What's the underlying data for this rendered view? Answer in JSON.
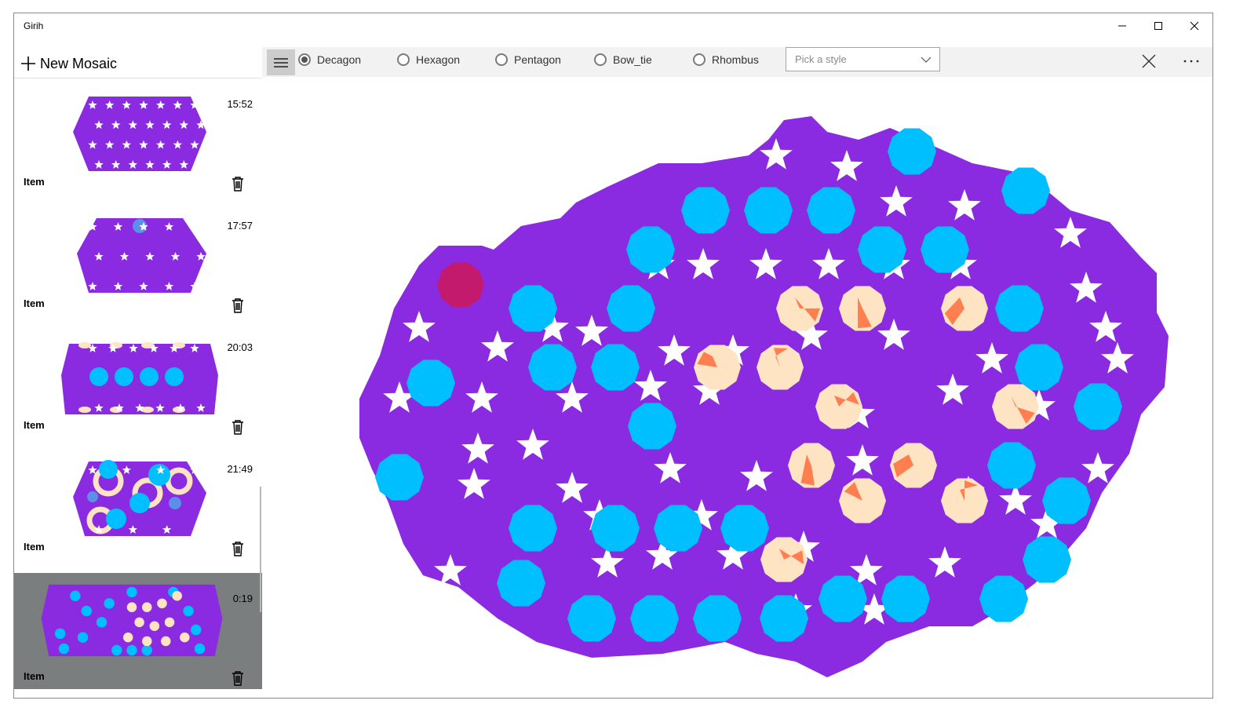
{
  "window": {
    "title": "Girih"
  },
  "sidebar": {
    "new_label": "New Mosaic",
    "items": [
      {
        "time": "15:52",
        "label": "Item"
      },
      {
        "time": "17:57",
        "label": "Item"
      },
      {
        "time": "20:03",
        "label": "Item"
      },
      {
        "time": "21:49",
        "label": "Item"
      },
      {
        "time": "0:19",
        "label": "Item",
        "selected": true
      }
    ]
  },
  "toolbar": {
    "tiles": [
      {
        "label": "Decagon",
        "checked": true
      },
      {
        "label": "Hexagon",
        "checked": false
      },
      {
        "label": "Pentagon",
        "checked": false
      },
      {
        "label": "Bow_tie",
        "checked": false
      },
      {
        "label": "Rhombus",
        "checked": false
      }
    ],
    "style_placeholder": "Pick a style"
  },
  "colors": {
    "purple": "#8a2be2",
    "cyan": "#00bfff",
    "cream": "#ffe4c4",
    "orange": "#ff7f50",
    "highlight": "#dc143c",
    "selected_bg": "#7a7e7f"
  }
}
